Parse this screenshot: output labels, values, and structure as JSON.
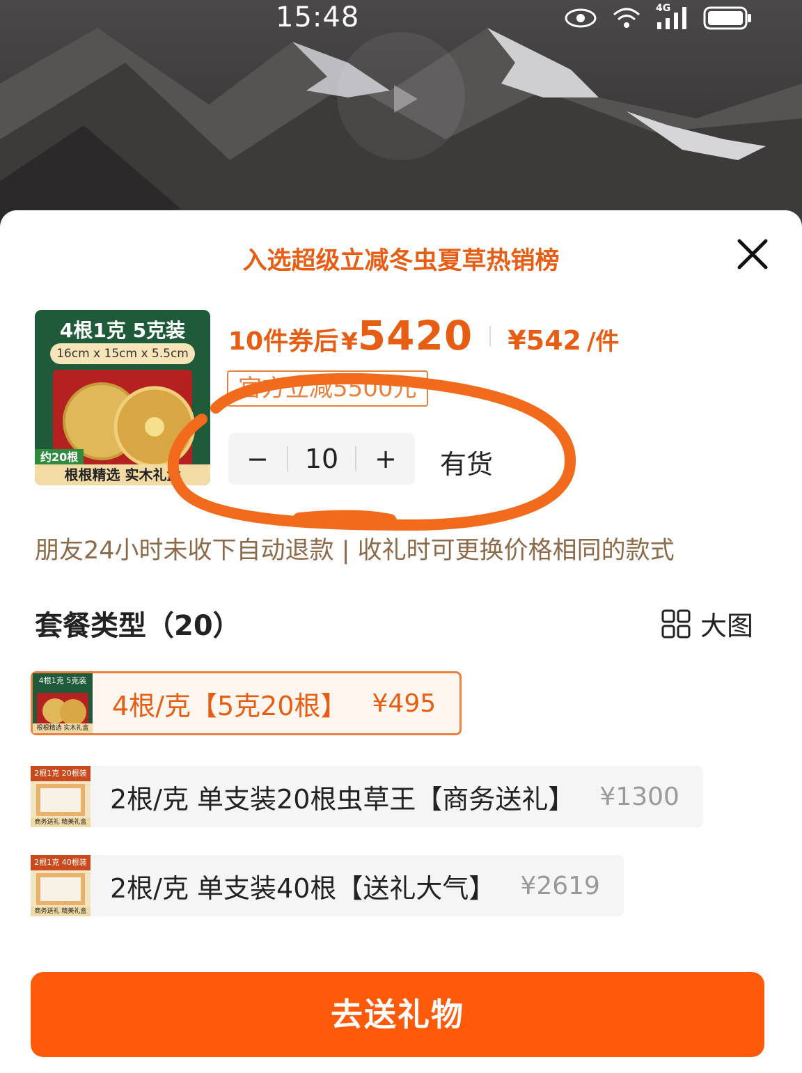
{
  "status_bar": {
    "time": "15:48",
    "network": "4G"
  },
  "sheet": {
    "rank_banner": "入选超级立减冬虫夏草热销榜",
    "product": {
      "thumb_title": "4根1克 5克装",
      "thumb_dims": "16cm x 15cm x 5.5cm",
      "thumb_count": "约20根",
      "thumb_tag": "根根精选 实木礼盒"
    },
    "price": {
      "prefix": "10件券后",
      "currency": "¥",
      "total": "5420",
      "unit_price": "¥542",
      "per": "/件"
    },
    "promo_badge": "官方立减5500元",
    "quantity": {
      "minus": "−",
      "value": "10",
      "plus": "+"
    },
    "stock_status": "有货",
    "refund_note": "朋友24小时未收下自动退款 | 收礼时可更换价格相同的款式",
    "section_title": "套餐类型（20）",
    "large_view_label": "大图",
    "options": [
      {
        "label": "4根/克【5克20根】",
        "price": "¥495",
        "thumb_title": "4根1克 5克装",
        "thumb_foot": "根根精选 实木礼盒",
        "selected": true
      },
      {
        "label": "2根/克 单支装20根虫草王【商务送礼】",
        "price": "¥1300",
        "thumb_title": "2根1克 20根装",
        "thumb_foot": "商务送礼 精美礼盒",
        "selected": false
      },
      {
        "label": "2根/克 单支装40根【送礼大气】",
        "price": "¥2619",
        "thumb_title": "2根1克 40根装",
        "thumb_foot": "商务送礼 精美礼盒",
        "selected": false
      }
    ],
    "gift_button": "去送礼物"
  },
  "colors": {
    "accent": "#ff5a0a",
    "price": "#e85d14",
    "annotation": "#f26a1b"
  }
}
